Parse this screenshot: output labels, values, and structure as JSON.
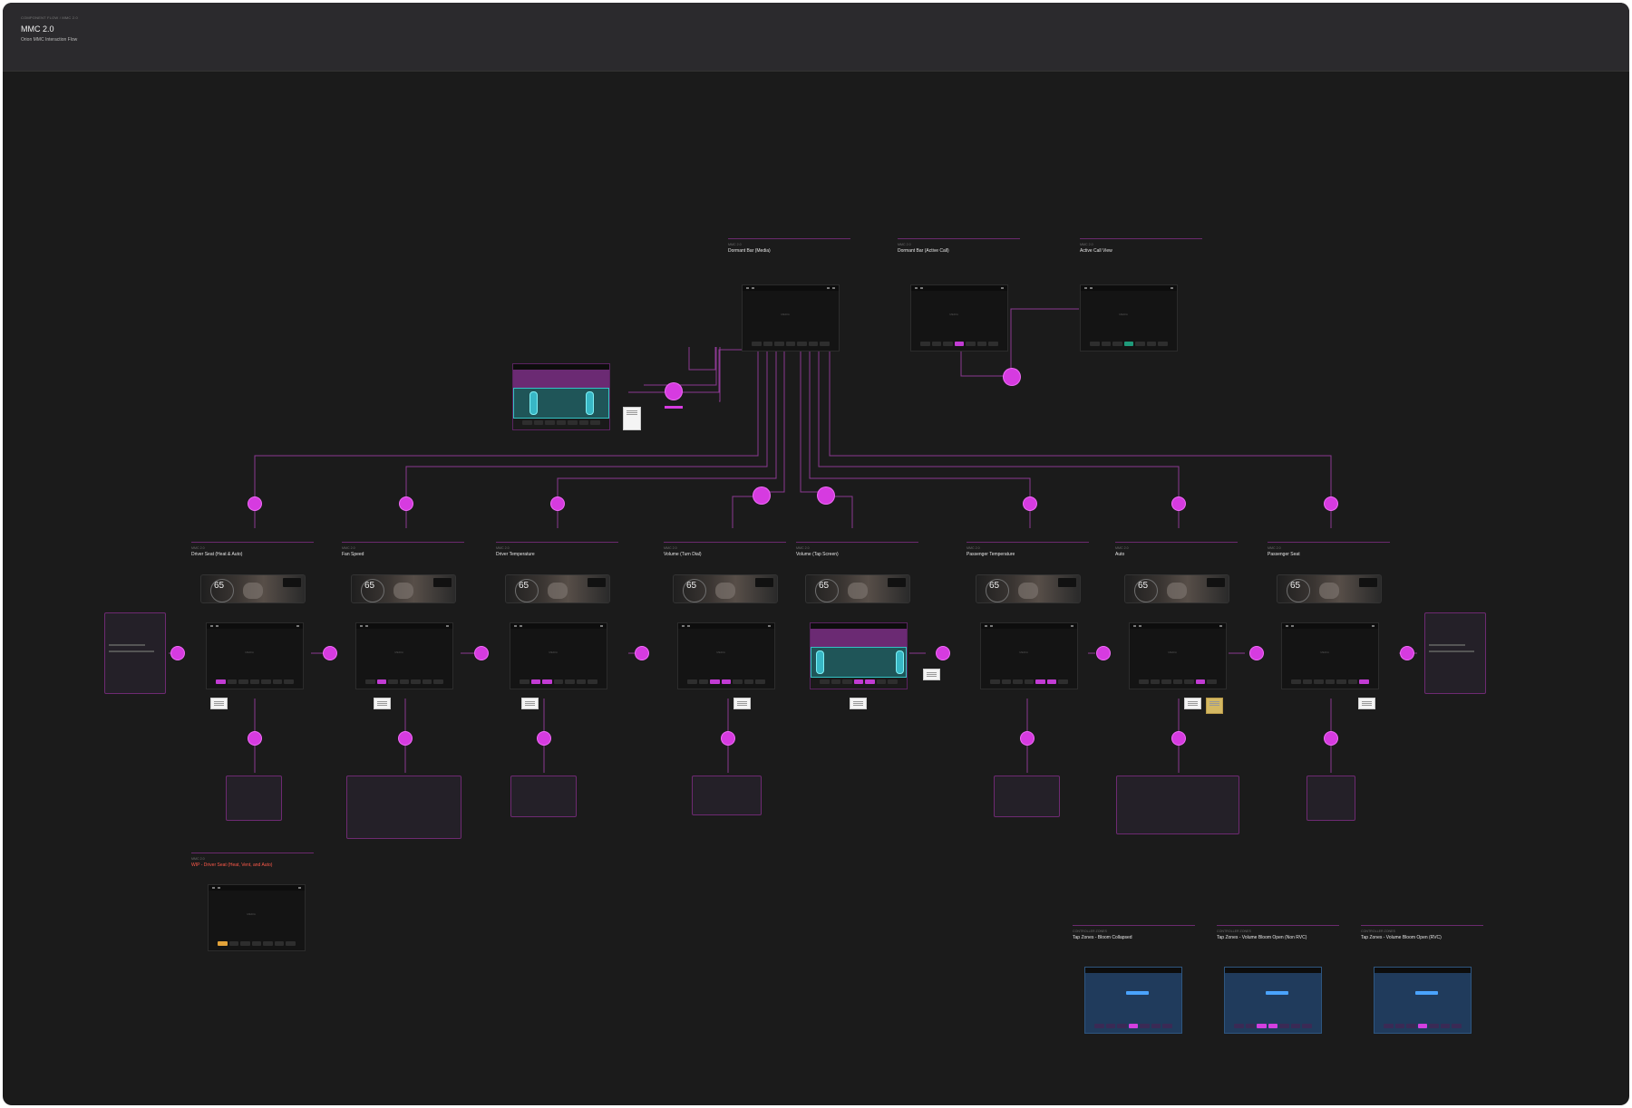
{
  "header": {
    "breadcrumb": "COMPONENT FLOW / MMC 2.0",
    "title": "MMC 2.0",
    "subtitle": "Orion MMC Interaction Flow"
  },
  "screen_common": {
    "media_label": "MEDIA",
    "speed": "65"
  },
  "top_sections": [
    {
      "kicker": "MMC 2.0",
      "name": "Dormant Bar (Media)"
    },
    {
      "kicker": "MMC 2.0",
      "name": "Dormant Bar (Active Call)"
    },
    {
      "kicker": "MMC 2.0",
      "name": "Active Call View"
    }
  ],
  "flow_sections": [
    {
      "kicker": "MMC 2.0",
      "name": "Driver Seat (Heat & Auto)"
    },
    {
      "kicker": "MMC 2.0",
      "name": "Fan Speed"
    },
    {
      "kicker": "MMC 2.0",
      "name": "Driver Temperature"
    },
    {
      "kicker": "MMC 2.0",
      "name": "Volume (Turn Dial)"
    },
    {
      "kicker": "MMC 2.0",
      "name": "Volume (Tap Screen)"
    },
    {
      "kicker": "MMC 2.0",
      "name": "Passenger Temperature"
    },
    {
      "kicker": "MMC 2.0",
      "name": "Auto"
    },
    {
      "kicker": "MMC 2.0",
      "name": "Passenger Seat"
    }
  ],
  "wip_section": {
    "kicker": "MMC 2.0",
    "name": "WIP - Driver Seat (Heat, Vent, and Auto)"
  },
  "controller_sections": [
    {
      "kicker": "CONTROLLER ZONES",
      "name": "Tap Zones - Bloom Collapsed"
    },
    {
      "kicker": "CONTROLLER ZONES",
      "name": "Tap Zones - Volume Bloom Open (Non RVC)"
    },
    {
      "kicker": "CONTROLLER ZONES",
      "name": "Tap Zones - Volume Bloom Open (RVC)"
    }
  ],
  "colors": {
    "accent": "#d63be0",
    "connector": "#8b3a92",
    "canvas": "#1b1b1b",
    "teal": "#34c2c4",
    "warning_text": "#ff5a4a"
  }
}
